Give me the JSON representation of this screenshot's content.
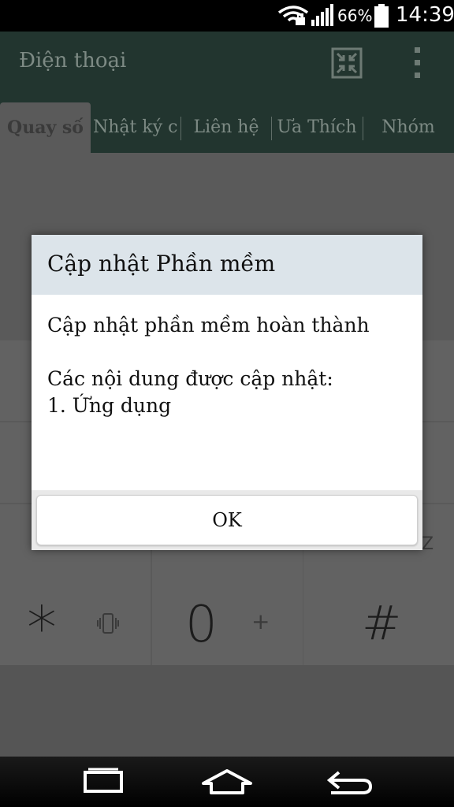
{
  "status_bar": {
    "battery_percent": "66%",
    "time": "14:39",
    "icons": [
      "wifi-icon",
      "signal-icon",
      "battery-icon"
    ]
  },
  "action_bar": {
    "title": "Điện thoại",
    "icons": [
      "compress-icon",
      "overflow-menu-icon"
    ]
  },
  "tabs": [
    {
      "label": "Quay số",
      "active": true
    },
    {
      "label": "Nhật ký cu",
      "active": false
    },
    {
      "label": "Liên hệ",
      "active": false
    },
    {
      "label": "Ưa Thích",
      "active": false
    },
    {
      "label": "Nhóm",
      "active": false
    }
  ],
  "keypad": {
    "row4": [
      {
        "main": "*",
        "sub": "vibrate-icon"
      },
      {
        "main": "0",
        "sub": "+"
      },
      {
        "main": "#",
        "sub": ""
      }
    ],
    "partial_letters": [
      "Z"
    ]
  },
  "dialog": {
    "title": "Cập nhật Phần mềm",
    "message_line1": "Cập nhật phần mềm hoàn thành",
    "message_line2": "Các nội dung được cập nhật:",
    "message_line3": "1. Ứng dụng",
    "ok_label": "OK"
  },
  "nav_bar": {
    "icons": [
      "recent-apps-icon",
      "home-icon",
      "back-icon"
    ]
  },
  "colors": {
    "action_bar": "#22352f",
    "dialog_header": "#dce4ea",
    "overlay_bg": "#5a5a5a"
  }
}
